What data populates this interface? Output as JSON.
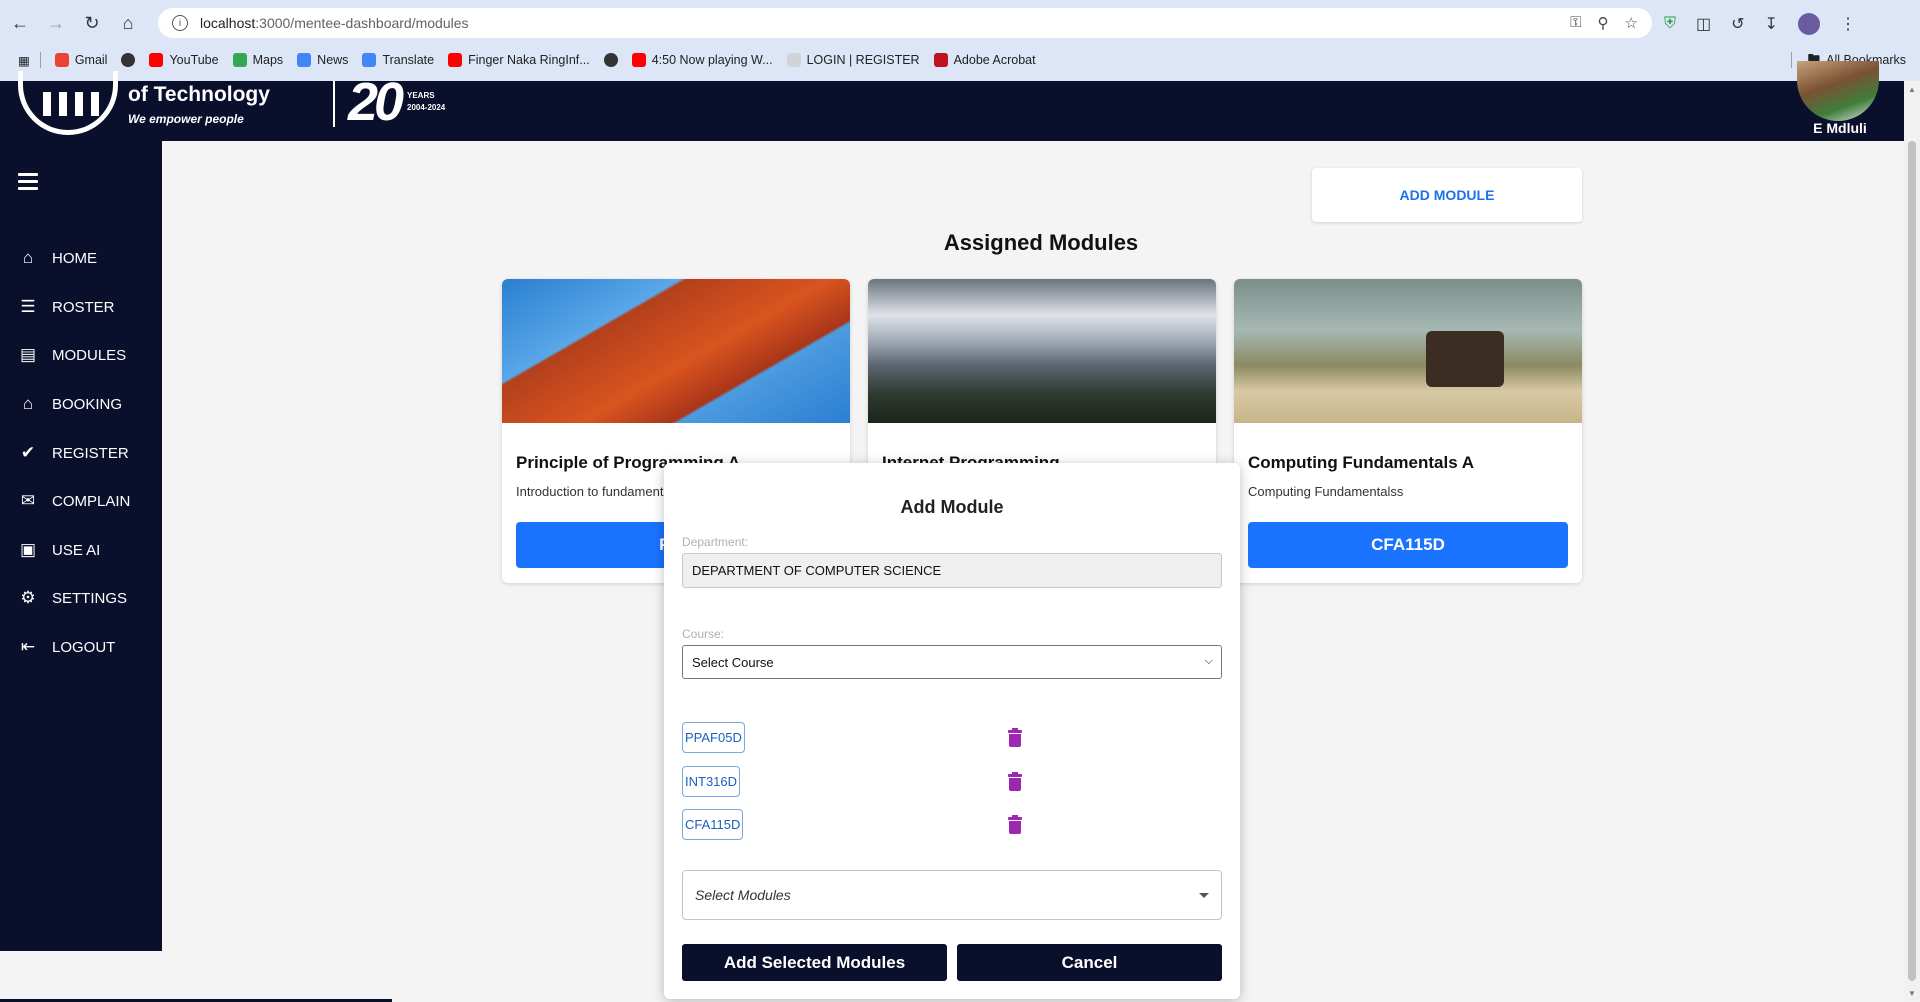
{
  "browser": {
    "url_host": "localhost",
    "url_path": ":3000/mentee-dashboard/modules",
    "bookmarks": [
      {
        "label": "Gmail",
        "icon": "gmail-icon",
        "color": "#ea4335"
      },
      {
        "label": "",
        "icon": "globe-icon",
        "color": "#333333"
      },
      {
        "label": "YouTube",
        "icon": "youtube-icon",
        "color": "#ff0000"
      },
      {
        "label": "Maps",
        "icon": "maps-icon",
        "color": "#34a853"
      },
      {
        "label": "News",
        "icon": "news-icon",
        "color": "#4285f4"
      },
      {
        "label": "Translate",
        "icon": "translate-icon",
        "color": "#4285f4"
      },
      {
        "label": "Finger Naka RingInf...",
        "icon": "youtube-icon",
        "color": "#ff0000"
      },
      {
        "label": "",
        "icon": "globe-icon",
        "color": "#333333"
      },
      {
        "label": "4:50 Now playing W...",
        "icon": "youtube-icon",
        "color": "#ff0000"
      },
      {
        "label": "LOGIN | REGISTER",
        "icon": "page-icon",
        "color": "#9aa0a6"
      },
      {
        "label": "Adobe Acrobat",
        "icon": "acrobat-icon",
        "color": "#c1121f"
      }
    ],
    "all_bookmarks": "All Bookmarks"
  },
  "header": {
    "logo_line1": "of Technology",
    "logo_line2": "We empower people",
    "anniversary_number": "20",
    "anniversary_years": "YEARS",
    "anniversary_range": "2004-2024",
    "user_name": "E Mdluli"
  },
  "sidebar": {
    "items": [
      {
        "label": "HOME",
        "icon": "home-icon"
      },
      {
        "label": "ROSTER",
        "icon": "list-icon"
      },
      {
        "label": "MODULES",
        "icon": "book-icon"
      },
      {
        "label": "BOOKING",
        "icon": "home-icon"
      },
      {
        "label": "REGISTER",
        "icon": "bookmark-check-icon"
      },
      {
        "label": "COMPLAIN",
        "icon": "message-alert-icon"
      },
      {
        "label": "USE AI",
        "icon": "robot-icon"
      },
      {
        "label": "SETTINGS",
        "icon": "gear-icon"
      },
      {
        "label": "LOGOUT",
        "icon": "logout-icon"
      }
    ]
  },
  "main": {
    "add_module_label": "ADD MODULE",
    "section_title": "Assigned Modules",
    "cards": [
      {
        "title": "Principle of Programming A",
        "description": "Introduction to fundamenta",
        "code": "PPA"
      },
      {
        "title": "Internet Programming",
        "description": "",
        "code": ""
      },
      {
        "title": "Computing Fundamentals A",
        "description": "Computing Fundamentalss",
        "code": "CFA115D"
      }
    ]
  },
  "modal": {
    "title": "Add Module",
    "department_label": "Department:",
    "department_value": "DEPARTMENT OF COMPUTER SCIENCE",
    "course_label": "Course:",
    "course_value": "Select Course",
    "selected_modules": [
      "PPAF05D",
      "INT316D",
      "CFA115D"
    ],
    "modules_placeholder": "Select Modules",
    "add_button": "Add Selected Modules",
    "cancel_button": "Cancel"
  },
  "colors": {
    "navy": "#0a0f2c",
    "primary_blue": "#1a73ff",
    "trash_purple": "#9c27b0"
  }
}
